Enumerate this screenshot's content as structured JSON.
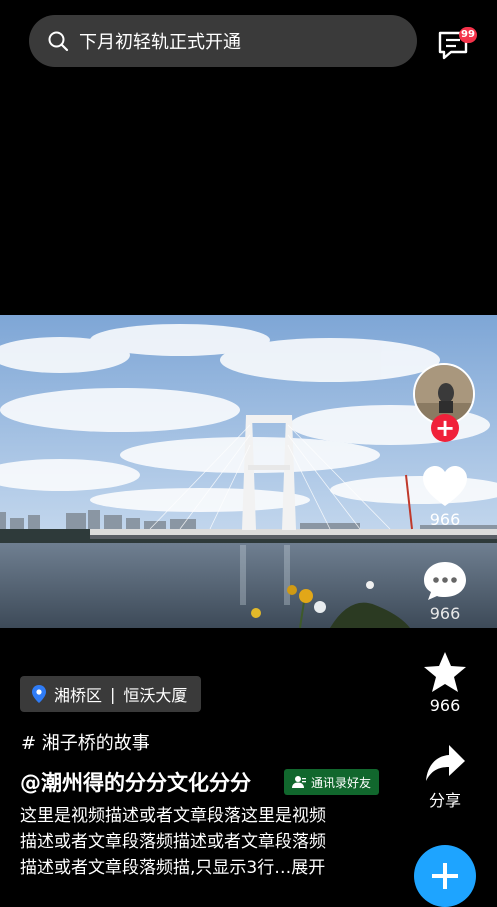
{
  "search": {
    "text": "下月初轻轨正式开通"
  },
  "header": {
    "badge_count": "99"
  },
  "actions": {
    "like_count": "966",
    "comment_count": "966",
    "favorite_count": "966",
    "share_label": "分享"
  },
  "location": {
    "district": "湘桥区",
    "place": "恒沃大厦",
    "separator": "|"
  },
  "topic": "# 湘子桥的故事",
  "author": {
    "name": "@潮州得的分分文化分分",
    "tag": "通讯录好友"
  },
  "description": {
    "line1": "这里是视频描述或者文章段落这里是视频",
    "line2": "描述或者文章段落频描述或者文章段落频",
    "line3": "描述或者文章段落频描,只显示3行…展开"
  },
  "icons": {
    "search": "search-icon",
    "message": "message-icon",
    "like": "heart-icon",
    "comment": "comment-icon",
    "favorite": "star-icon",
    "share": "share-icon",
    "add": "plus-icon",
    "location": "location-pin-icon",
    "contact": "contact-icon"
  },
  "colors": {
    "badge": "#f5324a",
    "follow": "#f0213a",
    "add_button": "#1ea4ff",
    "contact_tag": "#11672d",
    "location_pin": "#2f7cf6"
  }
}
